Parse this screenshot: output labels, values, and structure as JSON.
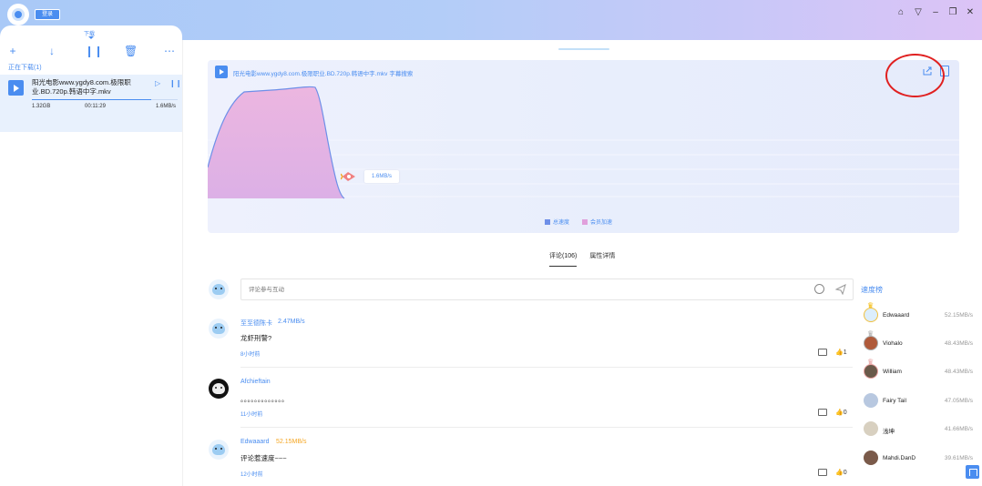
{
  "header": {
    "login_label": "登录",
    "window_controls": [
      "shirt-icon",
      "dropdown-icon",
      "minimize-icon",
      "restore-icon",
      "close-icon"
    ]
  },
  "left_panel": {
    "tab_label": "下载",
    "toolbar": [
      "plus-icon",
      "download-icon",
      "pause-icon",
      "delete-icon",
      "more-icon"
    ],
    "section_label": "正在下载(1)",
    "task": {
      "name": "阳光电影www.ygdy8.com.极限职业.BD.720p.韩语中字.mkv",
      "size": "1.32GB",
      "remaining": "00:11:29",
      "speed": "1.6MB/s",
      "progress": 0.82
    }
  },
  "graph": {
    "title": "阳光电影www.ygdy8.com.极限职业.BD.720p.韩语中字.mkv",
    "subtitle_link": "字幕搜索",
    "speed_tag": "1.6MB/s",
    "legend": {
      "total": "总速度",
      "member": "会员加速"
    }
  },
  "tabs": [
    "评论(106)",
    "属性详情"
  ],
  "comment_input": {
    "placeholder": "评论参与互动"
  },
  "comments": [
    {
      "author": "至至德陈卡",
      "speed": "2.47MB/s",
      "speed_color": "blue",
      "text": "龙虾刑警?",
      "time": "8小时前",
      "likes": "1"
    },
    {
      "author": "Afchieftain",
      "speed": "",
      "speed_color": "blue",
      "text": "。。。。。。。。。。。。。",
      "time": "11小时前",
      "likes": "0"
    },
    {
      "author": "Edwaaard",
      "speed": "52.15MB/s",
      "speed_color": "orange",
      "text": "评论惹速度~~~",
      "time": "12小时前",
      "likes": "0"
    }
  ],
  "ranking": {
    "title": "速度榜",
    "items": [
      {
        "name": "Edwaaard",
        "speed": "52.15MB/s"
      },
      {
        "name": "Viohalo",
        "speed": "48.43MB/s"
      },
      {
        "name": "William",
        "speed": "48.43MB/s"
      },
      {
        "name": "Fairy Tail",
        "speed": "47.05MB/s"
      },
      {
        "name": "浅坤",
        "speed": "41.66MB/s"
      },
      {
        "name": "Mahdi.DanD",
        "speed": "39.61MB/s"
      }
    ]
  }
}
